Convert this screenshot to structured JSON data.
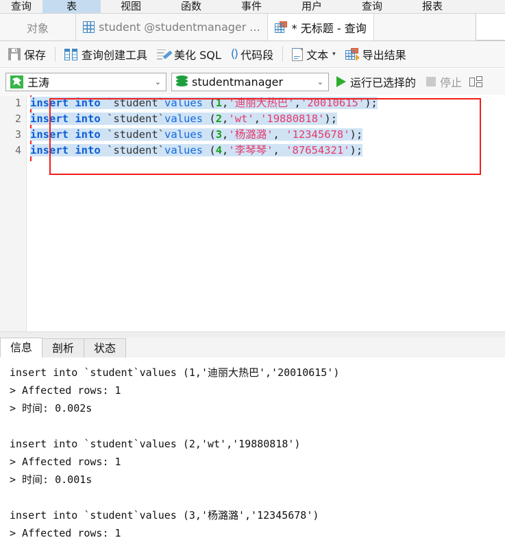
{
  "object_tabs": [
    {
      "label": "查询",
      "active": false,
      "clipped": true
    },
    {
      "label": "表",
      "active": true
    },
    {
      "label": "视图",
      "active": false
    },
    {
      "label": "函数",
      "active": false
    },
    {
      "label": "事件",
      "active": false
    },
    {
      "label": "用户",
      "active": false
    },
    {
      "label": "查询",
      "active": false
    },
    {
      "label": "报表",
      "active": false
    }
  ],
  "doc_tabs": {
    "objects_label": "对象",
    "tabs": [
      {
        "label": "student @studentmanager ...",
        "icon": "table-grid-icon",
        "active": false
      },
      {
        "label": "* 无标题 - 查询",
        "icon": "query-grid-icon",
        "active": true
      }
    ]
  },
  "toolbar": {
    "save_label": "保存",
    "query_builder_label": "查询创建工具",
    "beautify_label": "美化 SQL",
    "snippet_label": "代码段",
    "text_label": "文本",
    "export_label": "导出结果"
  },
  "connbar": {
    "connection": "王涛",
    "database": "studentmanager",
    "run_selected_label": "运行已选择的",
    "stop_label": "停止"
  },
  "editor": {
    "line_numbers": [
      "1",
      "2",
      "3",
      "4"
    ],
    "lines": [
      {
        "num": "1",
        "selected": true,
        "tokens": [
          {
            "t": "insert",
            "c": "kw"
          },
          {
            "t": " ",
            "c": "punct"
          },
          {
            "t": "into",
            "c": "kw"
          },
          {
            "t": " ",
            "c": "punct"
          },
          {
            "t": "`student`",
            "c": "ident"
          },
          {
            "t": "values",
            "c": "kwl"
          },
          {
            "t": " (",
            "c": "punct"
          },
          {
            "t": "1",
            "c": "num"
          },
          {
            "t": ",",
            "c": "punct"
          },
          {
            "t": "'迪丽大热巴'",
            "c": "str"
          },
          {
            "t": ",",
            "c": "punct"
          },
          {
            "t": "'20010615'",
            "c": "str"
          },
          {
            "t": ");",
            "c": "punct"
          }
        ]
      },
      {
        "num": "2",
        "selected": true,
        "tokens": [
          {
            "t": "insert",
            "c": "kw"
          },
          {
            "t": " ",
            "c": "punct"
          },
          {
            "t": "into",
            "c": "kw"
          },
          {
            "t": " ",
            "c": "punct"
          },
          {
            "t": "`student`",
            "c": "ident"
          },
          {
            "t": "values",
            "c": "kwl"
          },
          {
            "t": " (",
            "c": "punct"
          },
          {
            "t": "2",
            "c": "num"
          },
          {
            "t": ",",
            "c": "punct"
          },
          {
            "t": "'wt'",
            "c": "str"
          },
          {
            "t": ",",
            "c": "punct"
          },
          {
            "t": "'19880818'",
            "c": "str"
          },
          {
            "t": ");",
            "c": "punct"
          }
        ]
      },
      {
        "num": "3",
        "selected": true,
        "tokens": [
          {
            "t": "insert",
            "c": "kw"
          },
          {
            "t": " ",
            "c": "punct"
          },
          {
            "t": "into",
            "c": "kw"
          },
          {
            "t": " ",
            "c": "punct"
          },
          {
            "t": "`student`",
            "c": "ident"
          },
          {
            "t": "values",
            "c": "kwl"
          },
          {
            "t": " (",
            "c": "punct"
          },
          {
            "t": "3",
            "c": "num"
          },
          {
            "t": ",",
            "c": "punct"
          },
          {
            "t": "'杨潞潞'",
            "c": "str"
          },
          {
            "t": ", ",
            "c": "punct"
          },
          {
            "t": "'12345678'",
            "c": "str"
          },
          {
            "t": ");",
            "c": "punct"
          }
        ]
      },
      {
        "num": "4",
        "selected": true,
        "tokens": [
          {
            "t": "insert",
            "c": "kw"
          },
          {
            "t": " ",
            "c": "punct"
          },
          {
            "t": "into",
            "c": "kw"
          },
          {
            "t": " ",
            "c": "punct"
          },
          {
            "t": "`student`",
            "c": "ident"
          },
          {
            "t": "values",
            "c": "kwl"
          },
          {
            "t": " (",
            "c": "punct"
          },
          {
            "t": "4",
            "c": "num"
          },
          {
            "t": ",",
            "c": "punct"
          },
          {
            "t": "'李琴琴'",
            "c": "str"
          },
          {
            "t": ", ",
            "c": "punct"
          },
          {
            "t": "'87654321'",
            "c": "str"
          },
          {
            "t": ");",
            "c": "punct"
          }
        ]
      }
    ],
    "selection_highlight_color": "#cfe3f5",
    "selection_box_color": "#f21b1b"
  },
  "result_panel": {
    "tabs": [
      {
        "label": "信息",
        "active": true
      },
      {
        "label": "剖析",
        "active": false
      },
      {
        "label": "状态",
        "active": false
      }
    ],
    "log_lines": [
      "insert into `student`values (1,'迪丽大热巴','20010615')",
      "> Affected rows: 1",
      "> 时间: 0.002s",
      "",
      "insert into `student`values (2,'wt','19880818')",
      "> Affected rows: 1",
      "> 时间: 0.001s",
      "",
      "insert into `student`values (3,'杨潞潞','12345678')",
      "> Affected rows: 1"
    ]
  }
}
